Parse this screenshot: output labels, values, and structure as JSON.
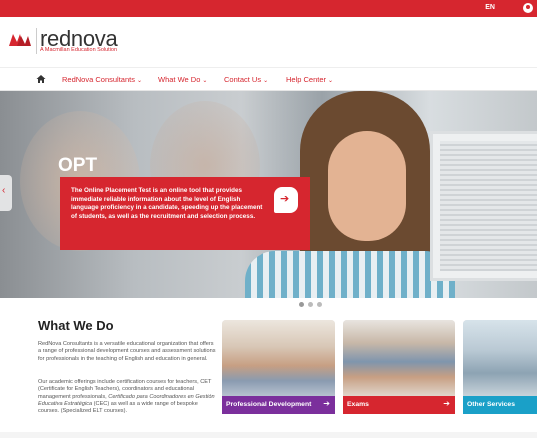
{
  "topbar": {
    "lang": "EN"
  },
  "brand": {
    "name": "rednova",
    "tagline": "A Macmillan Education Solution",
    "accent": "#d6262f"
  },
  "nav": {
    "items": [
      {
        "label": "RedNova Consultants"
      },
      {
        "label": "What We Do"
      },
      {
        "label": "Contact Us"
      },
      {
        "label": "Help Center"
      }
    ]
  },
  "hero": {
    "title": "OPT",
    "description": "The Online Placement Test is an online tool that provides immediate reliable information about the level of English language proficiency in a candidate, speeding up the placement of students, as well as the recruitment and selection process.",
    "slides": 3,
    "active_slide": 1
  },
  "what_we_do": {
    "title": "What We Do",
    "intro": "RedNova Consultants is a versatile educational organization that offers a range of professional development courses and assessment solutions for professionals in the teaching of English and education in general.",
    "offer_prefix": "Our academic offerings include certification courses for teachers, CET (Certificate for English Teachers), coordinators and educational management professionals, ",
    "offer_italic": "Certificado para Coordinadores en Gestión Educativa Estratégica",
    "offer_suffix": " (CEC) as well as a wide range of bespoke courses. (Specialized ELT courses)."
  },
  "cards": [
    {
      "label": "Professional Development",
      "color": "#7b2f9c"
    },
    {
      "label": "Exams",
      "color": "#d6262f"
    },
    {
      "label": "Other Services",
      "color": "#1aa0c8"
    }
  ]
}
